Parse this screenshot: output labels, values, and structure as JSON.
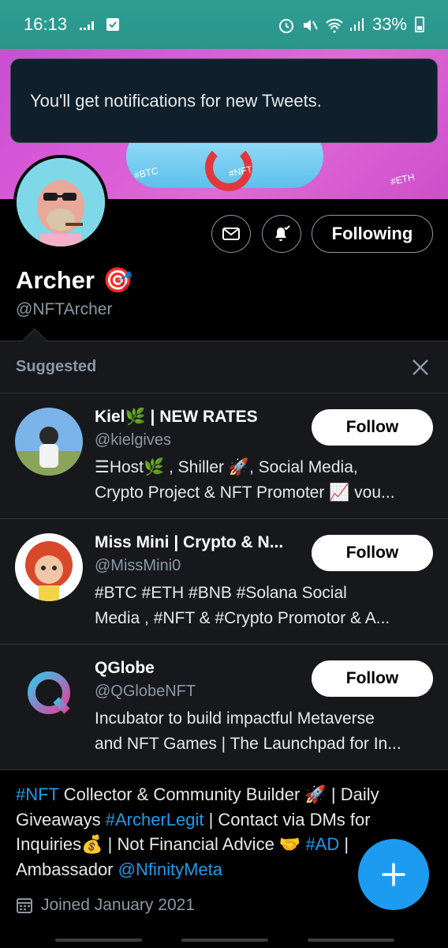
{
  "status_bar": {
    "time": "16:13",
    "battery": "33%"
  },
  "toast": {
    "message": "You'll get notifications for new Tweets."
  },
  "profile": {
    "name": "Archer",
    "name_emoji": "🎯",
    "handle": "@NFTArcher",
    "following_label": "Following"
  },
  "banner": {
    "tags": [
      "#BTC",
      "#NFT",
      "#ETH"
    ]
  },
  "suggested": {
    "title": "Suggested",
    "items": [
      {
        "name": "Kiel🌿 | NEW RATES",
        "handle": "@kielgives",
        "bio_line1": "☰Host🌿 , Shiller 🚀, Social Media,",
        "bio_line2": "Crypto Project & NFT Promoter 📈  vou...",
        "button": "Follow"
      },
      {
        "name": "Miss Mini | Crypto & N...",
        "handle": "@MissMini0",
        "bio_line1": "#BTC #ETH #BNB #Solana  Social",
        "bio_line2": "Media , #NFT & #Crypto Promotor & A...",
        "button": "Follow"
      },
      {
        "name": "QGlobe",
        "handle": "@QGlobeNFT",
        "bio_line1": "Incubator to build impactful Metaverse",
        "bio_line2": "and NFT Games | The Launchpad for In...",
        "button": "Follow"
      }
    ]
  },
  "bio": {
    "l1_link": "#NFT",
    "l1_text": " Collector & Community Builder 🚀 | Daily",
    "l2_text": "Giveaways ",
    "l2_link": "#ArcherLegit",
    "l2_text2": " | Contact via DMs for",
    "l3_text": "Inquiries💰 | Not Financial Advice 🤝 ",
    "l3_link": "#AD",
    "l3_text2": " |",
    "l4_text": "Ambassador ",
    "l4_link": "@NfinityMeta"
  },
  "joined": "Joined January 2021",
  "colors": {
    "accent": "#1d9bf0",
    "status_bar": "#2a958b",
    "background": "#000000"
  }
}
